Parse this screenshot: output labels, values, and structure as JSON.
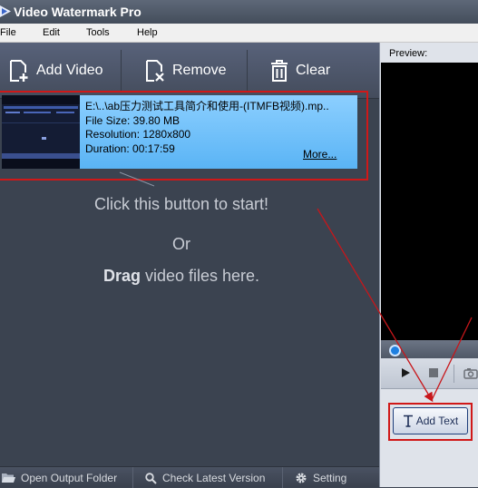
{
  "window": {
    "title": "Video Watermark Pro"
  },
  "menu": [
    "File",
    "Edit",
    "Tools",
    "Help"
  ],
  "toolbar": {
    "add_video": "Add Video",
    "remove": "Remove",
    "clear": "Clear"
  },
  "video": {
    "path": "E:\\..\\ab压力测试工具简介和使用-(ITMFB视频).mp..",
    "file_size": "File Size: 39.80 MB",
    "resolution": "Resolution: 1280x800",
    "duration": "Duration: 00:17:59",
    "more": "More..."
  },
  "hint": {
    "line1": "Click this button to start!",
    "line2": "Or",
    "drag_bold": "Drag",
    "drag_rest": " video files here."
  },
  "status": {
    "open_output": "Open Output Folder",
    "check_version": "Check Latest Version",
    "setting": "Setting"
  },
  "preview": {
    "label": "Preview:"
  },
  "addtext": {
    "label": "Add Text"
  },
  "colors": {
    "accent_red": "#d01818",
    "selection_blue": "#6cc0fa",
    "panel_dark": "#3b4350"
  }
}
